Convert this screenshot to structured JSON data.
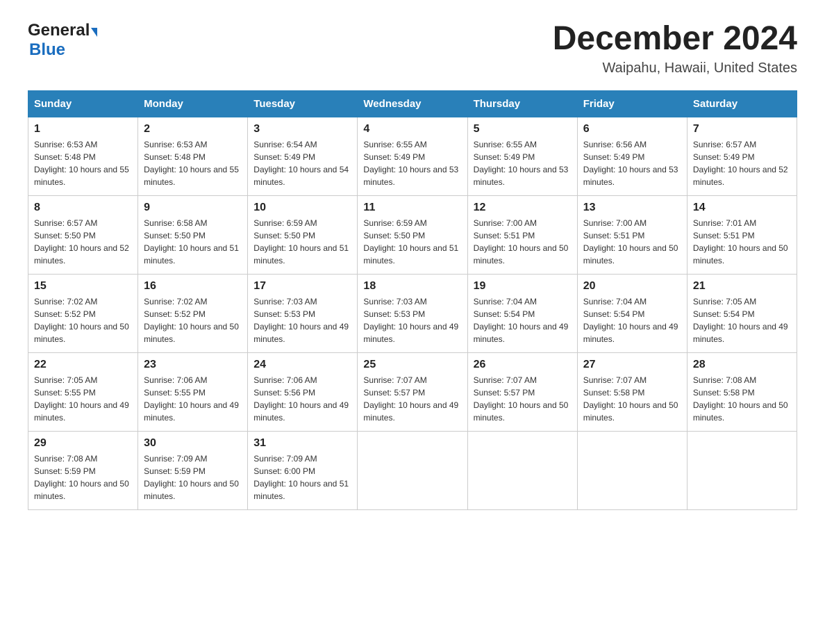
{
  "header": {
    "logo_general": "General",
    "logo_blue": "Blue",
    "month_title": "December 2024",
    "location": "Waipahu, Hawaii, United States"
  },
  "weekdays": [
    "Sunday",
    "Monday",
    "Tuesday",
    "Wednesday",
    "Thursday",
    "Friday",
    "Saturday"
  ],
  "weeks": [
    [
      {
        "day": "1",
        "sunrise": "6:53 AM",
        "sunset": "5:48 PM",
        "daylight": "10 hours and 55 minutes."
      },
      {
        "day": "2",
        "sunrise": "6:53 AM",
        "sunset": "5:48 PM",
        "daylight": "10 hours and 55 minutes."
      },
      {
        "day": "3",
        "sunrise": "6:54 AM",
        "sunset": "5:49 PM",
        "daylight": "10 hours and 54 minutes."
      },
      {
        "day": "4",
        "sunrise": "6:55 AM",
        "sunset": "5:49 PM",
        "daylight": "10 hours and 53 minutes."
      },
      {
        "day": "5",
        "sunrise": "6:55 AM",
        "sunset": "5:49 PM",
        "daylight": "10 hours and 53 minutes."
      },
      {
        "day": "6",
        "sunrise": "6:56 AM",
        "sunset": "5:49 PM",
        "daylight": "10 hours and 53 minutes."
      },
      {
        "day": "7",
        "sunrise": "6:57 AM",
        "sunset": "5:49 PM",
        "daylight": "10 hours and 52 minutes."
      }
    ],
    [
      {
        "day": "8",
        "sunrise": "6:57 AM",
        "sunset": "5:50 PM",
        "daylight": "10 hours and 52 minutes."
      },
      {
        "day": "9",
        "sunrise": "6:58 AM",
        "sunset": "5:50 PM",
        "daylight": "10 hours and 51 minutes."
      },
      {
        "day": "10",
        "sunrise": "6:59 AM",
        "sunset": "5:50 PM",
        "daylight": "10 hours and 51 minutes."
      },
      {
        "day": "11",
        "sunrise": "6:59 AM",
        "sunset": "5:50 PM",
        "daylight": "10 hours and 51 minutes."
      },
      {
        "day": "12",
        "sunrise": "7:00 AM",
        "sunset": "5:51 PM",
        "daylight": "10 hours and 50 minutes."
      },
      {
        "day": "13",
        "sunrise": "7:00 AM",
        "sunset": "5:51 PM",
        "daylight": "10 hours and 50 minutes."
      },
      {
        "day": "14",
        "sunrise": "7:01 AM",
        "sunset": "5:51 PM",
        "daylight": "10 hours and 50 minutes."
      }
    ],
    [
      {
        "day": "15",
        "sunrise": "7:02 AM",
        "sunset": "5:52 PM",
        "daylight": "10 hours and 50 minutes."
      },
      {
        "day": "16",
        "sunrise": "7:02 AM",
        "sunset": "5:52 PM",
        "daylight": "10 hours and 50 minutes."
      },
      {
        "day": "17",
        "sunrise": "7:03 AM",
        "sunset": "5:53 PM",
        "daylight": "10 hours and 49 minutes."
      },
      {
        "day": "18",
        "sunrise": "7:03 AM",
        "sunset": "5:53 PM",
        "daylight": "10 hours and 49 minutes."
      },
      {
        "day": "19",
        "sunrise": "7:04 AM",
        "sunset": "5:54 PM",
        "daylight": "10 hours and 49 minutes."
      },
      {
        "day": "20",
        "sunrise": "7:04 AM",
        "sunset": "5:54 PM",
        "daylight": "10 hours and 49 minutes."
      },
      {
        "day": "21",
        "sunrise": "7:05 AM",
        "sunset": "5:54 PM",
        "daylight": "10 hours and 49 minutes."
      }
    ],
    [
      {
        "day": "22",
        "sunrise": "7:05 AM",
        "sunset": "5:55 PM",
        "daylight": "10 hours and 49 minutes."
      },
      {
        "day": "23",
        "sunrise": "7:06 AM",
        "sunset": "5:55 PM",
        "daylight": "10 hours and 49 minutes."
      },
      {
        "day": "24",
        "sunrise": "7:06 AM",
        "sunset": "5:56 PM",
        "daylight": "10 hours and 49 minutes."
      },
      {
        "day": "25",
        "sunrise": "7:07 AM",
        "sunset": "5:57 PM",
        "daylight": "10 hours and 49 minutes."
      },
      {
        "day": "26",
        "sunrise": "7:07 AM",
        "sunset": "5:57 PM",
        "daylight": "10 hours and 50 minutes."
      },
      {
        "day": "27",
        "sunrise": "7:07 AM",
        "sunset": "5:58 PM",
        "daylight": "10 hours and 50 minutes."
      },
      {
        "day": "28",
        "sunrise": "7:08 AM",
        "sunset": "5:58 PM",
        "daylight": "10 hours and 50 minutes."
      }
    ],
    [
      {
        "day": "29",
        "sunrise": "7:08 AM",
        "sunset": "5:59 PM",
        "daylight": "10 hours and 50 minutes."
      },
      {
        "day": "30",
        "sunrise": "7:09 AM",
        "sunset": "5:59 PM",
        "daylight": "10 hours and 50 minutes."
      },
      {
        "day": "31",
        "sunrise": "7:09 AM",
        "sunset": "6:00 PM",
        "daylight": "10 hours and 51 minutes."
      },
      null,
      null,
      null,
      null
    ]
  ]
}
